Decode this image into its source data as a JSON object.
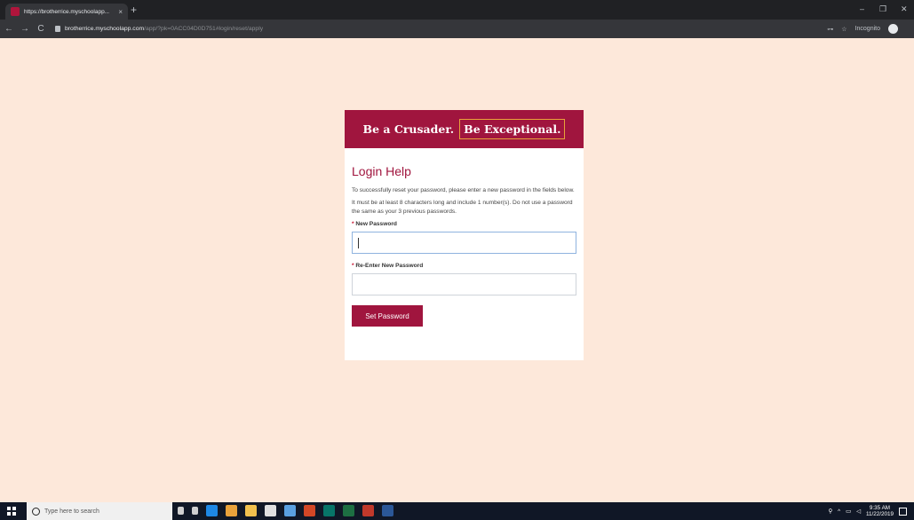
{
  "browser": {
    "tab_title": "https://brotherrice.myschoolapp...",
    "tab_close": "×",
    "new_tab": "+",
    "window_controls": [
      "–",
      "❐",
      "✕"
    ],
    "nav": {
      "back": "←",
      "forward": "→",
      "reload": "C"
    },
    "url_host": "brotherrice.myschoolapp.com",
    "url_path": "/app/?pk=0ACC04D0D751#login/reset/apply",
    "incognito_label": "Incognito",
    "star": "☆",
    "key": "⊶"
  },
  "banner": {
    "part1": "Be a Crusader.",
    "part2": "Be Exceptional."
  },
  "form": {
    "heading": "Login Help",
    "instructions": "To successfully reset your password, please enter a new password in the fields below.",
    "rules": "It must be at least 8 characters long and include 1 number(s). Do not use a password the same as your 3 previous passwords.",
    "required_marker": "*",
    "new_password_label": "New Password",
    "reenter_label": "Re-Enter New Password",
    "submit_label": "Set Password"
  },
  "taskbar": {
    "search_placeholder": "Type here to search",
    "time": "9:35 AM",
    "date": "11/22/2019",
    "icons": [
      "mic-icon",
      "task-view-icon",
      "edge-icon",
      "chrome-icon",
      "file-explorer-icon",
      "store-icon",
      "mail-icon",
      "powerpoint-icon",
      "publisher-icon",
      "excel-icon",
      "app-icon",
      "word-icon"
    ],
    "icon_colors": [
      "#cfcfcf",
      "#cfcfcf",
      "#1e88e5",
      "#e9a23b",
      "#f2c14e",
      "#e0e0e0",
      "#5aa0e0",
      "#d24726",
      "#077568",
      "#1d6f42",
      "#c0392b",
      "#2b5797"
    ]
  }
}
